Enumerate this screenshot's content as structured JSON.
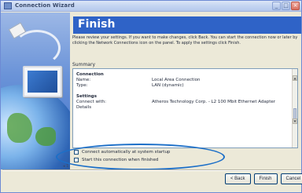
{
  "window": {
    "title": "Connection Wizard",
    "controls": {
      "minimize": "_",
      "maximize": "□",
      "close": "×"
    }
  },
  "page": {
    "heading": "Finish",
    "intro": "Please review your settings. If you want to make changes, click Back. You can start the connection now or later by clicking the Network Connections icon on the panel. To apply the settings click Finish.",
    "summary_label": "Summary"
  },
  "summary": {
    "connection": {
      "title": "Connection",
      "rows": [
        {
          "key": "Name:",
          "value": "Local Area Connection"
        },
        {
          "key": "Type:",
          "value": "LAN (dynamic)"
        }
      ]
    },
    "settings": {
      "title": "Settings",
      "rows": [
        {
          "key": "Connect with:",
          "value": "Atheros Technology Corp. - L2 100 Mbit Ethernet Adapter"
        }
      ]
    },
    "details_label": "Details"
  },
  "options": [
    {
      "label": "Connect automatically at system startup",
      "checked": false
    },
    {
      "label": "Start this connection when finished",
      "checked": false
    }
  ],
  "buttons": {
    "back": "< Back",
    "finish": "Finish",
    "cancel": "Cancel"
  },
  "misc": {
    "back_marker": "◂ 1"
  },
  "colors": {
    "heading_bg": "#2f63c7",
    "highlight_ellipse": "#1c6fc8"
  }
}
